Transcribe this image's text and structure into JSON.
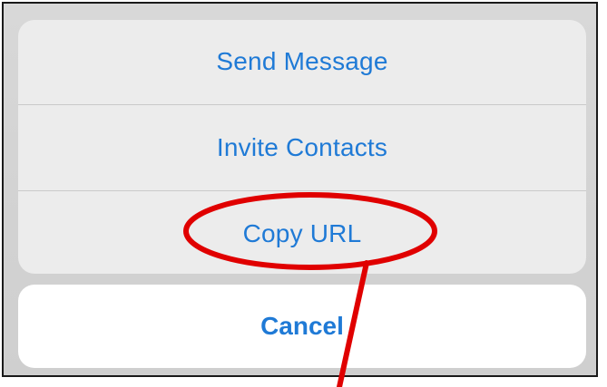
{
  "action_sheet": {
    "items": [
      {
        "label": "Send Message"
      },
      {
        "label": "Invite Contacts"
      },
      {
        "label": "Copy URL"
      }
    ],
    "cancel_label": "Cancel"
  },
  "colors": {
    "action_text": "#1f7ad6",
    "annotation": "#e00000"
  }
}
